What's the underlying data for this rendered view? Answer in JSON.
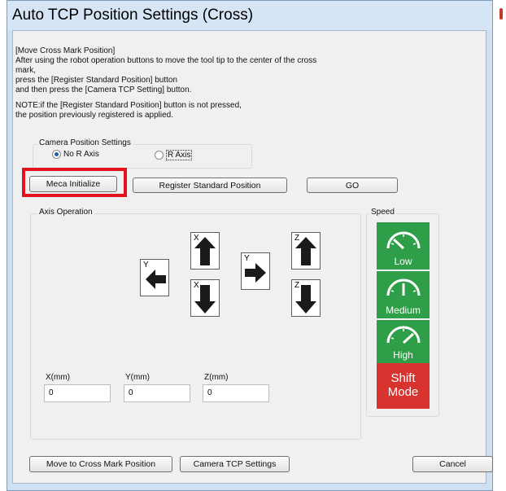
{
  "window": {
    "title": "Auto TCP Position Settings (Cross)"
  },
  "instructions": {
    "line1": "[Move Cross Mark Position]",
    "line2": " After using the robot operation buttons to move the tool tip to the center of the cross",
    "line3": "mark,",
    "line4": " press the [Register Standard Position] button",
    "line5": " and then press the [Camera TCP Setting] button.",
    "note1": "NOTE:if the [Register Standard Position] button is not pressed,",
    "note2": "the position previously registered is applied."
  },
  "camera_position": {
    "label": "Camera Position Settings",
    "options": [
      "No R Axis",
      "R Axis"
    ],
    "selected": "No R Axis"
  },
  "buttons": {
    "meca_initialize": "Meca Initialize",
    "register_standard": "Register Standard Position",
    "go": "GO",
    "move_to_cross": "Move to Cross Mark Position",
    "camera_tcp": "Camera TCP Settings",
    "cancel": "Cancel"
  },
  "axis_operation": {
    "label": "Axis Operation",
    "jog_buttons": [
      {
        "name": "y-minus",
        "letter": "Y",
        "arrow": "left"
      },
      {
        "name": "x-plus",
        "letter": "X",
        "arrow": "up"
      },
      {
        "name": "x-minus",
        "letter": "X",
        "arrow": "down"
      },
      {
        "name": "y-plus",
        "letter": "Y",
        "arrow": "right"
      },
      {
        "name": "z-plus",
        "letter": "Z",
        "arrow": "up"
      },
      {
        "name": "z-minus",
        "letter": "Z",
        "arrow": "down"
      }
    ],
    "fields": [
      {
        "label": "X(mm)",
        "value": "0"
      },
      {
        "label": "Y(mm)",
        "value": "0"
      },
      {
        "label": "Z(mm)",
        "value": "0"
      }
    ]
  },
  "speed": {
    "label": "Speed",
    "options": [
      "Low",
      "Medium",
      "High"
    ],
    "shift_mode_line1": "Shift",
    "shift_mode_line2": "Mode",
    "colors": {
      "speed": "#2f9e49",
      "shift": "#d9332f"
    }
  },
  "highlight_color": "#e2141b"
}
